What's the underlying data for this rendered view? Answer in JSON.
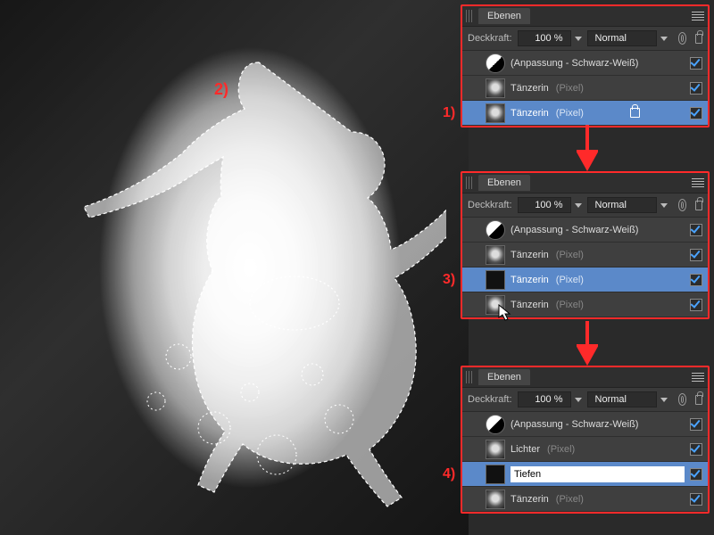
{
  "markers": {
    "m1": "1)",
    "m2": "2)",
    "m3": "3)",
    "m4": "4)"
  },
  "panel_common": {
    "tab_label": "Ebenen",
    "opacity_label": "Deckkraft:",
    "opacity_value": "100 %",
    "blend_mode": "Normal",
    "adjustment_layer": "(Anpassung - Schwarz-Weiß)",
    "pixel_suffix": "(Pixel)"
  },
  "panel1": {
    "layers": [
      {
        "name": "(Anpassung - Schwarz-Weiß)",
        "type": "",
        "thumb": "adj",
        "checked": true
      },
      {
        "name": "Tänzerin",
        "type": "(Pixel)",
        "thumb": "img",
        "checked": true
      },
      {
        "name": "Tänzerin",
        "type": "(Pixel)",
        "thumb": "img",
        "selected": true,
        "locked": true
      }
    ]
  },
  "panel2": {
    "layers": [
      {
        "name": "(Anpassung - Schwarz-Weiß)",
        "type": "",
        "thumb": "adj",
        "checked": true
      },
      {
        "name": "Tänzerin",
        "type": "(Pixel)",
        "thumb": "img",
        "checked": true
      },
      {
        "name": "Tänzerin",
        "type": "(Pixel)",
        "thumb": "dark",
        "selected": true,
        "checked": true
      },
      {
        "name": "Tänzerin",
        "type": "(Pixel)",
        "thumb": "img",
        "checked": true,
        "cursor": true
      }
    ]
  },
  "panel3": {
    "layers": [
      {
        "name": "(Anpassung - Schwarz-Weiß)",
        "type": "",
        "thumb": "adj",
        "checked": true
      },
      {
        "name": "Lichter",
        "type": "(Pixel)",
        "thumb": "img",
        "checked": true
      },
      {
        "name_input": "Tiefen",
        "thumb": "dark",
        "selected": true,
        "checked": true,
        "renaming": true
      },
      {
        "name": "Tänzerin",
        "type": "(Pixel)",
        "thumb": "img",
        "checked": true
      }
    ]
  }
}
